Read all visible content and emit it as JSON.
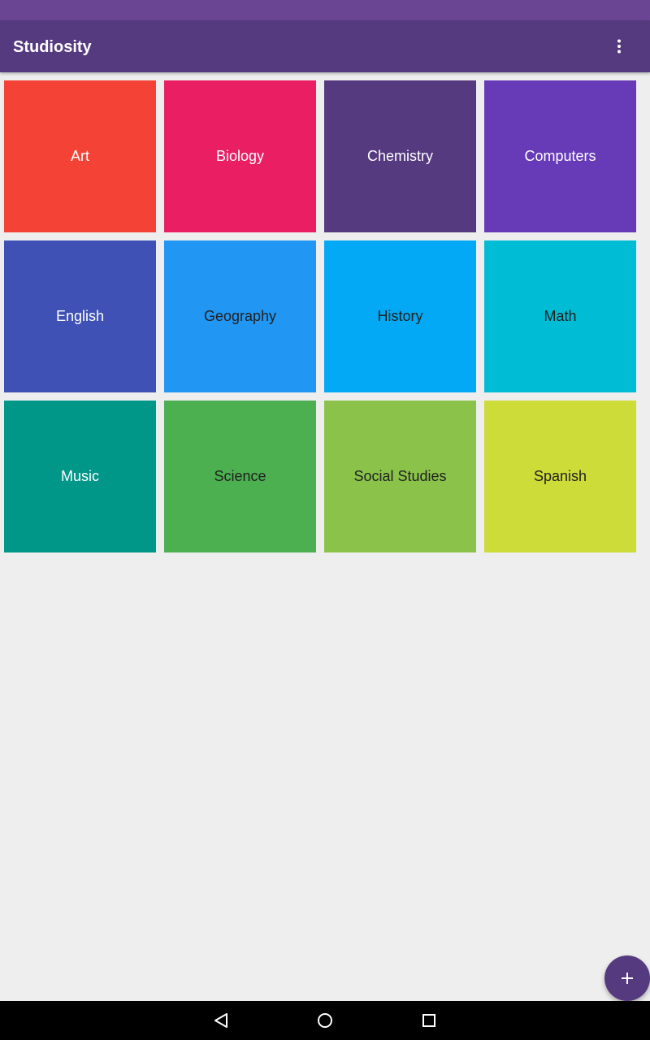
{
  "app": {
    "title": "Studiosity",
    "primary_color": "#553a80",
    "status_bar_color": "#6a4593"
  },
  "toolbar": {
    "overflow_icon": "more-vert-icon"
  },
  "subjects": [
    {
      "label": "Art",
      "color": "#f44336",
      "text_color": "#ffffff"
    },
    {
      "label": "Biology",
      "color": "#e91e63",
      "text_color": "#ffffff"
    },
    {
      "label": "Chemistry",
      "color": "#553a80",
      "text_color": "#ffffff"
    },
    {
      "label": "Computers",
      "color": "#673ab7",
      "text_color": "#ffffff"
    },
    {
      "label": "English",
      "color": "#3f51b5",
      "text_color": "#ffffff"
    },
    {
      "label": "Geography",
      "color": "#2196f3",
      "text_color": "#212121"
    },
    {
      "label": "History",
      "color": "#03a9f4",
      "text_color": "#212121"
    },
    {
      "label": "Math",
      "color": "#00bcd4",
      "text_color": "#212121"
    },
    {
      "label": "Music",
      "color": "#009688",
      "text_color": "#ffffff"
    },
    {
      "label": "Science",
      "color": "#4caf50",
      "text_color": "#212121"
    },
    {
      "label": "Social Studies",
      "color": "#8bc34a",
      "text_color": "#212121"
    },
    {
      "label": "Spanish",
      "color": "#cddc39",
      "text_color": "#212121"
    }
  ],
  "fab": {
    "icon": "plus-icon"
  },
  "nav_bar": {
    "icons": [
      "back-icon",
      "home-icon",
      "recents-icon"
    ]
  }
}
